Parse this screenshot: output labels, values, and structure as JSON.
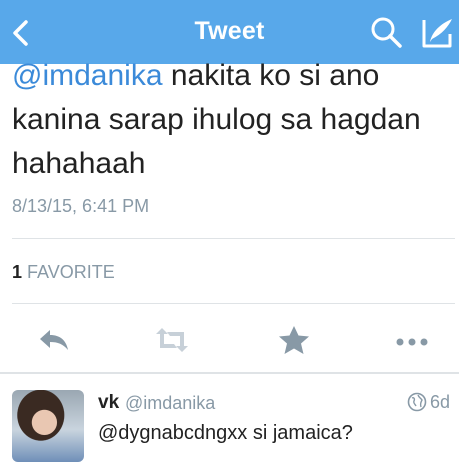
{
  "navbar": {
    "title": "Tweet"
  },
  "tweet": {
    "mention": "@imdanika",
    "text": " nakita ko si ano kanina sarap ihulog sa hagdan hahahaah",
    "timestamp": "8/13/15, 6:41 PM",
    "favorite_count": "1",
    "favorite_label": "FAVORITE"
  },
  "reply": {
    "name": "vk",
    "handle": "@imdanika",
    "age": "6d",
    "text": "@dygnabcdngxx si jamaica?"
  },
  "colors": {
    "navbar": "#58a8ea",
    "mention": "#3b8ad9",
    "secondary_text": "#8899a6",
    "icon_gray": "#8899a6"
  }
}
